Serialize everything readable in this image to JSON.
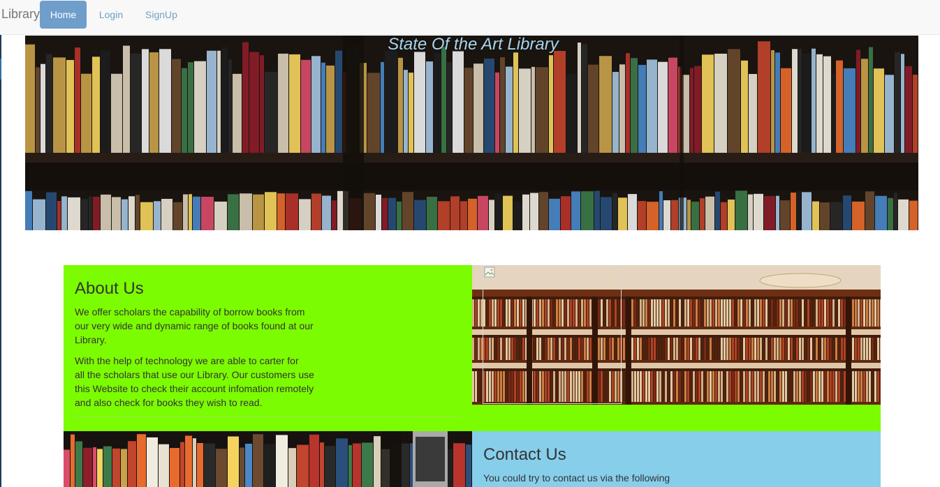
{
  "navbar": {
    "brand": "Library",
    "items": [
      {
        "label": "Home",
        "active": true
      },
      {
        "label": "Login",
        "active": false
      },
      {
        "label": "SignUp",
        "active": false
      }
    ]
  },
  "hero": {
    "title": "State Of the Art Library"
  },
  "about": {
    "title": "About Us",
    "paragraphs": [
      [
        "We offer scholars the capability of borrow books from",
        "our very wide and dynamic range of books found at our",
        "Library."
      ],
      [
        "With the help of technology we are able to carter for",
        "all the scholars that use our Library. Our customers use",
        "this Website to check their account infomation remotely",
        "and also check for books they wish to read."
      ]
    ]
  },
  "contact": {
    "title": "Contact Us",
    "text": "You could try to contact us via the following"
  },
  "colors": {
    "about_bg": "#7cfc00",
    "contact_bg": "#87ceeb",
    "nav_active": "#6f9ecb",
    "nav_link": "#6f9fc4",
    "hero_title": "#a7d5ee"
  }
}
